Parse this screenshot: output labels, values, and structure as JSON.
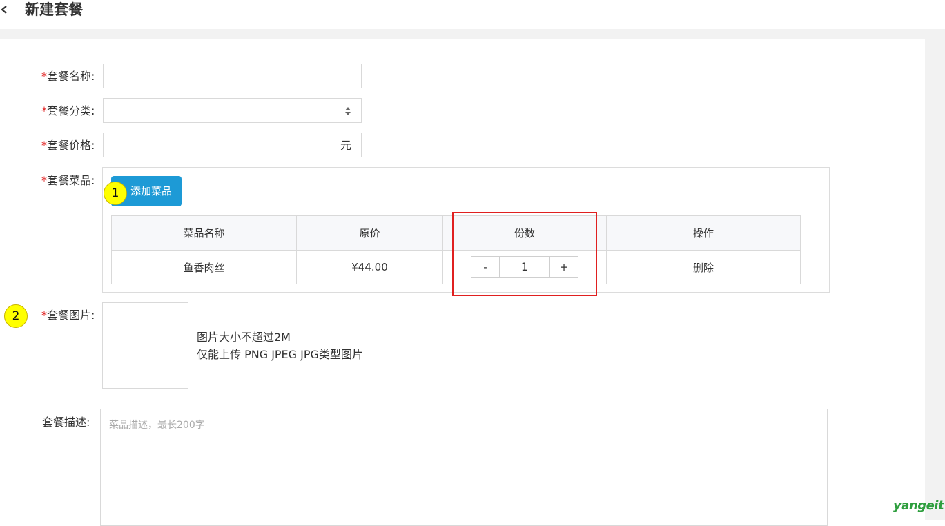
{
  "header": {
    "title": "新建套餐"
  },
  "form": {
    "name": {
      "label": "套餐名称:",
      "required_mark": "*",
      "value": ""
    },
    "category": {
      "label": "套餐分类:",
      "required_mark": "*",
      "selected": ""
    },
    "price": {
      "label": "套餐价格:",
      "required_mark": "*",
      "value": "",
      "unit": "元"
    },
    "dishes": {
      "label": "套餐菜品:",
      "required_mark": "*",
      "add_button": "添加菜品",
      "columns": [
        "菜品名称",
        "原价",
        "份数",
        "操作"
      ],
      "rows": [
        {
          "name": "鱼香肉丝",
          "price": "¥44.00",
          "qty_minus": "-",
          "qty": "1",
          "qty_plus": "+",
          "action": "删除"
        }
      ]
    },
    "image": {
      "label": "套餐图片:",
      "required_mark": "*",
      "hint_line1": "图片大小不超过2M",
      "hint_line2": "仅能上传 PNG JPEG JPG类型图片"
    },
    "description": {
      "label": "套餐描述:",
      "value": "",
      "placeholder": "菜品描述，最长200字"
    }
  },
  "annotations": {
    "marker_1": "1",
    "marker_2": "2",
    "highlight_color": "#e02020",
    "marker_color": "#ffff00"
  },
  "watermark": "yangeit",
  "colors": {
    "primary_button": "#1d9ad6",
    "required": "#e02020",
    "watermark": "#2e9e3e"
  }
}
